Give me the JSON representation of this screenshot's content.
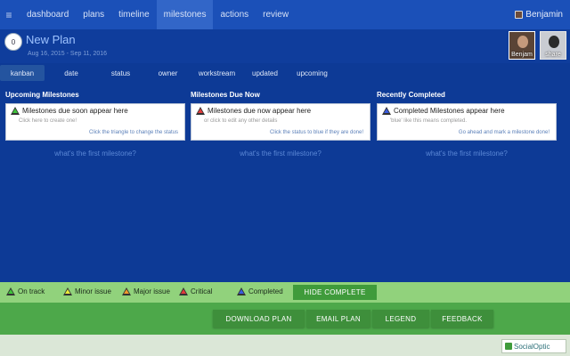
{
  "nav": {
    "items": [
      "dashboard",
      "plans",
      "timeline",
      "milestones",
      "actions",
      "review"
    ],
    "active": "milestones",
    "user_name": "Benjamin"
  },
  "plan": {
    "badge": "0",
    "title": "New Plan",
    "start_date": "Aug 16, 2015",
    "date_separator": "-",
    "end_date": "Sep 11, 2016"
  },
  "team": [
    {
      "label": "Benjam"
    },
    {
      "label": "share"
    }
  ],
  "sort_tabs": [
    "kanban",
    "date",
    "status",
    "owner",
    "workstream",
    "updated",
    "upcoming"
  ],
  "columns": [
    {
      "title": "Upcoming Milestones",
      "status_color": "green",
      "main": "Milestones due soon appear here",
      "sub": "Click here to create one!",
      "hint": "Click the triangle to change the status",
      "link": "what's the first milestone?"
    },
    {
      "title": "Milestones Due Now",
      "status_color": "red",
      "main": "Milestones due now appear here",
      "sub": "or click to edit any other details",
      "hint": "Click the status to blue if they are done!",
      "link": "what's the first milestone?"
    },
    {
      "title": "Recently Completed",
      "status_color": "blue",
      "main": "Completed Milestones appear here",
      "sub": "'blue' like this means completed.",
      "hint": "Go ahead and mark a milestone done!",
      "link": "what's the first milestone?"
    }
  ],
  "legend": {
    "items": [
      {
        "label": "On track",
        "color": "green"
      },
      {
        "label": "Minor issue",
        "color": "yellow"
      },
      {
        "label": "Major issue",
        "color": "orange"
      },
      {
        "label": "Critical",
        "color": "red"
      },
      {
        "label": "Completed",
        "color": "blue"
      }
    ],
    "hide_button": "HIDE COMPLETE"
  },
  "actions": [
    "DOWNLOAD PLAN",
    "EMAIL PLAN",
    "LEGEND",
    "FEEDBACK"
  ],
  "footer": {
    "logo_text": "SocialOptic"
  },
  "colors": {
    "nav_bg": "#1b50b8",
    "page_bg": "#0d3a96",
    "legend_bg": "#91d27c",
    "action_bg": "#4da84a",
    "button_bg": "#3e8f3b"
  },
  "icons": {
    "menu": "hamburger-icon",
    "user": "user-avatar-icon",
    "status": "triangle-status-icon"
  }
}
